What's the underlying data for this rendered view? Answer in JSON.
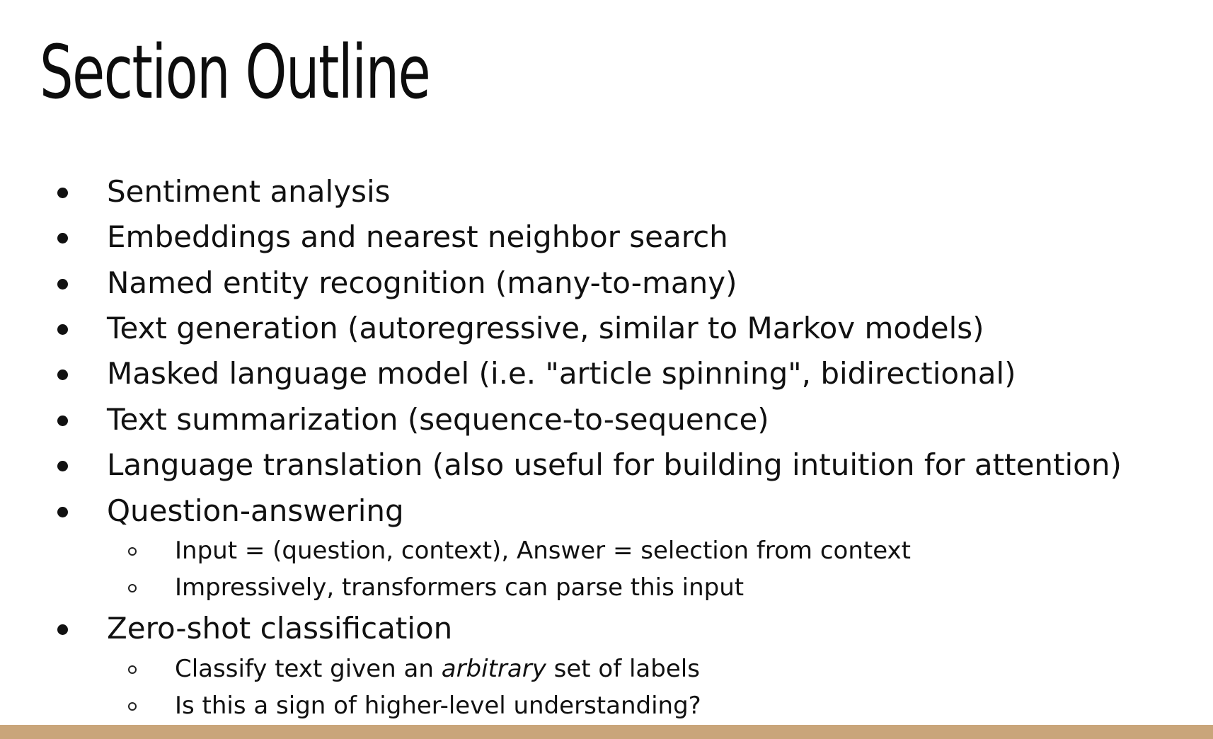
{
  "title": "Section Outline",
  "bullets": [
    "Sentiment analysis",
    "Embeddings and nearest neighbor search",
    "Named entity recognition (many-to-many)",
    "Text generation (autoregressive, similar to Markov models)",
    "Masked language model (i.e. \"article spinning\", bidirectional)",
    "Text summarization (sequence-to-sequence)",
    "Language translation (also useful for building intuition for attention)",
    "Question-answering",
    "Zero-shot classification"
  ],
  "question_answering_subpoints": [
    "Input = (question, context), Answer = selection from context",
    "Impressively, transformers can parse this input"
  ],
  "zero_shot_subpoints": [
    {
      "before": "Classify text given an ",
      "emphasis": "arbitrary",
      "after": " set of labels"
    },
    "Is this a sign of higher-level understanding?"
  ],
  "colors": {
    "background": "#ffffff",
    "text": "#111111",
    "accent_bar": "#c9a57a"
  }
}
